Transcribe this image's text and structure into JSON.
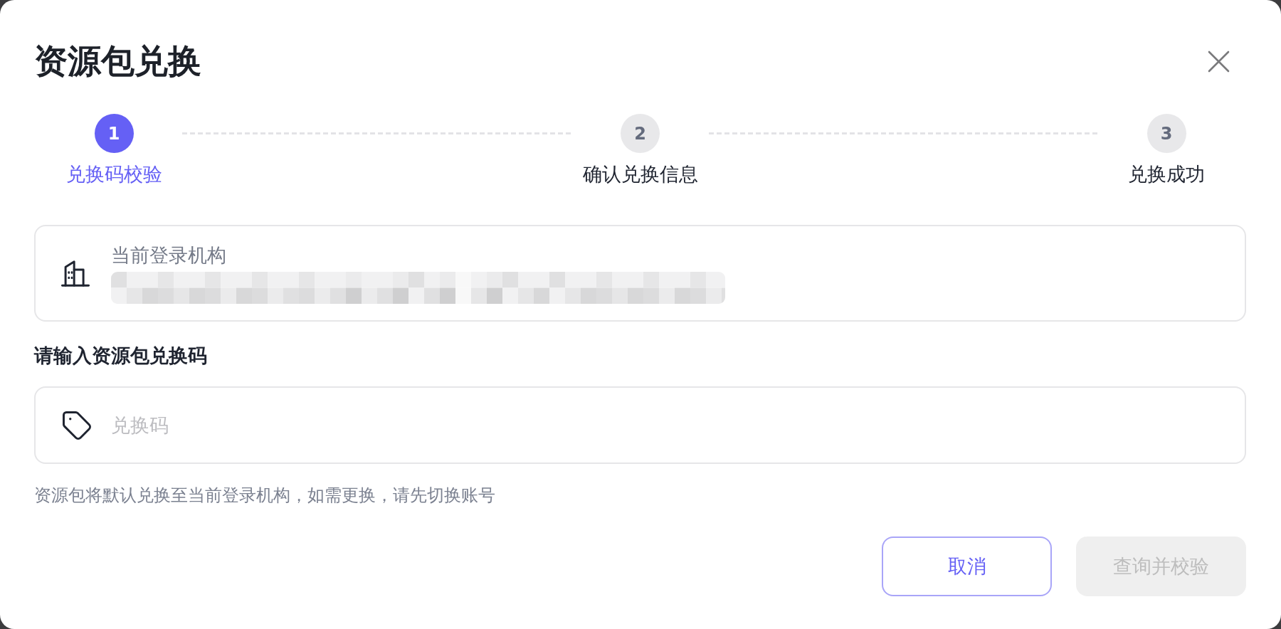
{
  "dialog": {
    "title": "资源包兑换"
  },
  "steps": [
    {
      "number": "1",
      "label": "兑换码校验",
      "active": true
    },
    {
      "number": "2",
      "label": "确认兑换信息",
      "active": false
    },
    {
      "number": "3",
      "label": "兑换成功",
      "active": false
    }
  ],
  "org_card": {
    "label": "当前登录机构"
  },
  "code_input": {
    "label": "请输入资源包兑换码",
    "placeholder": "兑换码"
  },
  "hint": "资源包将默认兑换至当前登录机构，如需更换，请先切换账号",
  "buttons": [
    {
      "label": "取消",
      "kind": "secondary",
      "disabled": false
    },
    {
      "label": "查询并校验",
      "kind": "primary",
      "disabled": true
    }
  ]
}
